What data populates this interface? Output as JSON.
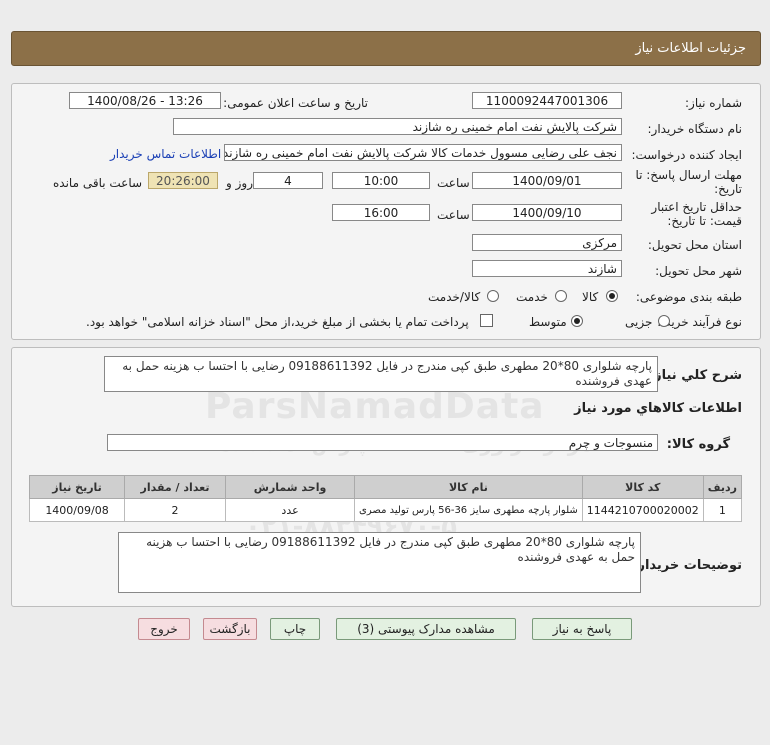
{
  "header": {
    "title": "جزئیات اطلاعات نیاز"
  },
  "form": {
    "need_number_label": "شماره نیاز:",
    "need_number": "1100092447001306",
    "announce_label": "تاریخ و ساعت اعلان عمومی:",
    "announce_value": "1400/08/26 - 13:26",
    "buyer_org_label": "نام دستگاه خریدار:",
    "buyer_org": "شرکت پالایش نفت امام خمینی  ره  شازند",
    "requester_label": "ایجاد کننده درخواست:",
    "requester": "نجف علی رضایی مسوول خدمات کالا شرکت پالایش نفت امام خمینی  ره  شازند",
    "contact_link": "اطلاعات تماس خریدار",
    "reply_deadline_label_1": "مهلت ارسال پاسخ: تا",
    "reply_deadline_label_2": "تاریخ:",
    "reply_date": "1400/09/01",
    "time_label": "ساعت",
    "reply_time": "10:00",
    "days": "4",
    "days_label": "روز و",
    "timer": "20:26:00",
    "remaining_label": "ساعت باقی مانده",
    "validity_label_1": "حداقل تاریخ اعتبار",
    "validity_label_2": "قیمت: تا تاریخ:",
    "validity_date": "1400/09/10",
    "validity_time_label": "ساعت",
    "validity_time": "16:00",
    "province_label": "استان محل تحویل:",
    "province": "مرکزی",
    "city_label": "شهر محل تحویل:",
    "city": "شازند",
    "category_label": "طبقه بندی موضوعی:",
    "category_options": [
      "کالا",
      "خدمت",
      "کالا/خدمت"
    ],
    "process_label": "نوع فرآیند خرید :",
    "process_options": [
      "جزیی",
      "متوسط"
    ],
    "payment_note": "پرداخت تمام یا بخشی از مبلغ خرید،از محل \"اسناد خزانه اسلامی\" خواهد بود."
  },
  "details": {
    "description_label": "شرح کلي نياز:",
    "description": "پارچه شلواری 80*20 مطهری طبق کپی مندرج در فایل 09188611392 رضایی با احتسا ب هزینه حمل به عهدی فروشنده",
    "goods_info_title": "اطلاعات کالاهاي مورد نياز",
    "goods_group_label": "گروه کالا:",
    "goods_group": "منسوجات و چرم",
    "table": {
      "headers": [
        "ردیف",
        "کد کالا",
        "نام کالا",
        "واحد شمارش",
        "تعداد / مقدار",
        "تاریخ نیاز"
      ],
      "rows": [
        [
          "1",
          "1144210700020002",
          "شلوار پارچه مطهری سایز 36-56 پارس تولید مصری",
          "عدد",
          "2",
          "1400/09/08"
        ]
      ]
    },
    "buyer_notes_label": "توضیحات خریدار:",
    "buyer_notes": "پارچه شلواری 80*20 مطهری طبق کپی مندرج در فایل 09188611392 رضایی با احتسا ب هزینه حمل به عهدی فروشنده"
  },
  "buttons": {
    "reply": "پاسخ به نیاز",
    "attachments": "مشاهده مدارک پیوستی (3)",
    "print": "چاپ",
    "back": "بازگشت",
    "exit": "خروج"
  },
  "watermark": {
    "brand": "ParsNamadData",
    "fa1": "مرکز فراوری اطلاعات پارس نماد داده",
    "fa2": "پایگاه اطلاع رسانی مناقصات و مزایدات",
    "phone": "۰۲۱-۸۸۳۴۹۶۷۰-۵"
  },
  "colors": {
    "header_bg": "#8c7048",
    "link": "#1a3fb5",
    "button_green": "#e3f1e1",
    "button_pink": "#f6dde0",
    "timer_bg": "#efe3b4"
  }
}
